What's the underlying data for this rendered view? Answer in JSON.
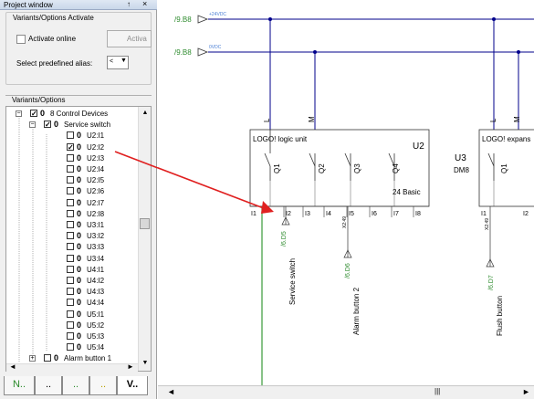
{
  "panel": {
    "title": "Project window",
    "pin_glyph": "↑",
    "close_glyph": "×",
    "activate_group": {
      "title": "Variants/Options Activate",
      "online_label": "Activate online",
      "activate_button": "Activa",
      "alias_label": "Select predefined alias:",
      "alias_value": "<"
    },
    "variants_label": "Variants/Options",
    "tree": [
      {
        "label": "8 Control Devices",
        "checked": true,
        "level": 0,
        "expander": "-"
      },
      {
        "label": "Service switch",
        "checked": true,
        "level": 1,
        "expander": "-"
      },
      {
        "label": "U2:I1",
        "checked": false,
        "level": 2
      },
      {
        "label": "U2:I2",
        "checked": true,
        "level": 2
      },
      {
        "label": "U2:I3",
        "checked": false,
        "level": 2
      },
      {
        "label": "U2:I4",
        "checked": false,
        "level": 2
      },
      {
        "label": "U2:I5",
        "checked": false,
        "level": 2
      },
      {
        "label": "U2:I6",
        "checked": false,
        "level": 2
      },
      {
        "label": "U2:I7",
        "checked": false,
        "level": 2
      },
      {
        "label": "U2:I8",
        "checked": false,
        "level": 2
      },
      {
        "label": "U3:I1",
        "checked": false,
        "level": 2
      },
      {
        "label": "U3:I2",
        "checked": false,
        "level": 2
      },
      {
        "label": "U3:I3",
        "checked": false,
        "level": 2
      },
      {
        "label": "U3:I4",
        "checked": false,
        "level": 2
      },
      {
        "label": "U4:I1",
        "checked": false,
        "level": 2
      },
      {
        "label": "U4:I2",
        "checked": false,
        "level": 2
      },
      {
        "label": "U4:I3",
        "checked": false,
        "level": 2
      },
      {
        "label": "U4:I4",
        "checked": false,
        "level": 2
      },
      {
        "label": "U5:I1",
        "checked": false,
        "level": 2
      },
      {
        "label": "U5:I2",
        "checked": false,
        "level": 2
      },
      {
        "label": "U5:I3",
        "checked": false,
        "level": 2
      },
      {
        "label": "U5:I4",
        "checked": false,
        "level": 2
      },
      {
        "label": "Alarm button 1",
        "checked": false,
        "level": 1,
        "expander": "+"
      }
    ],
    "tabs": [
      "N..",
      "..",
      "..",
      "..",
      "V.."
    ],
    "scroll_left": "◄",
    "scroll_right": "►"
  },
  "schematic": {
    "rail_24v": {
      "ref": "/9.B8",
      "voltage": "+24VDC"
    },
    "rail_0v": {
      "ref": "/9.B8",
      "voltage": "0VDC"
    },
    "u2": {
      "title": "LOGO! logic unit",
      "id": "U2",
      "variant": "24 Basic",
      "L": "L",
      "M": "M",
      "outputs": [
        "Q1",
        "Q2",
        "Q3",
        "Q4"
      ],
      "inputs": [
        "I1",
        "I2",
        "I3",
        "I4",
        "I5",
        "I6",
        "I7",
        "I8"
      ],
      "pin_tag": "X2:49"
    },
    "u3": {
      "title": "LOGO! expans",
      "id": "U3",
      "type": "DM8",
      "L": "L",
      "M": "M",
      "outputs": [
        "Q1"
      ],
      "inputs": [
        "I1",
        "I2"
      ],
      "pin_tag": "X2:49"
    },
    "wires": [
      {
        "ref": "/6.D5",
        "label": "Service switch"
      },
      {
        "ref": "/6.D6",
        "label": "Alarm button 2"
      },
      {
        "ref": "/6.D7",
        "label": "Flush button"
      }
    ],
    "colors": {
      "bus": "#00008b",
      "junction": "#00008b",
      "wire_green": "#3a9a3a",
      "arrow": "#e02020",
      "ref_green": "#2e8b2e",
      "voltage_blue": "#4a7fd4"
    }
  },
  "hscroll": {
    "left": "◄",
    "right": "►",
    "thumb": "|||"
  }
}
